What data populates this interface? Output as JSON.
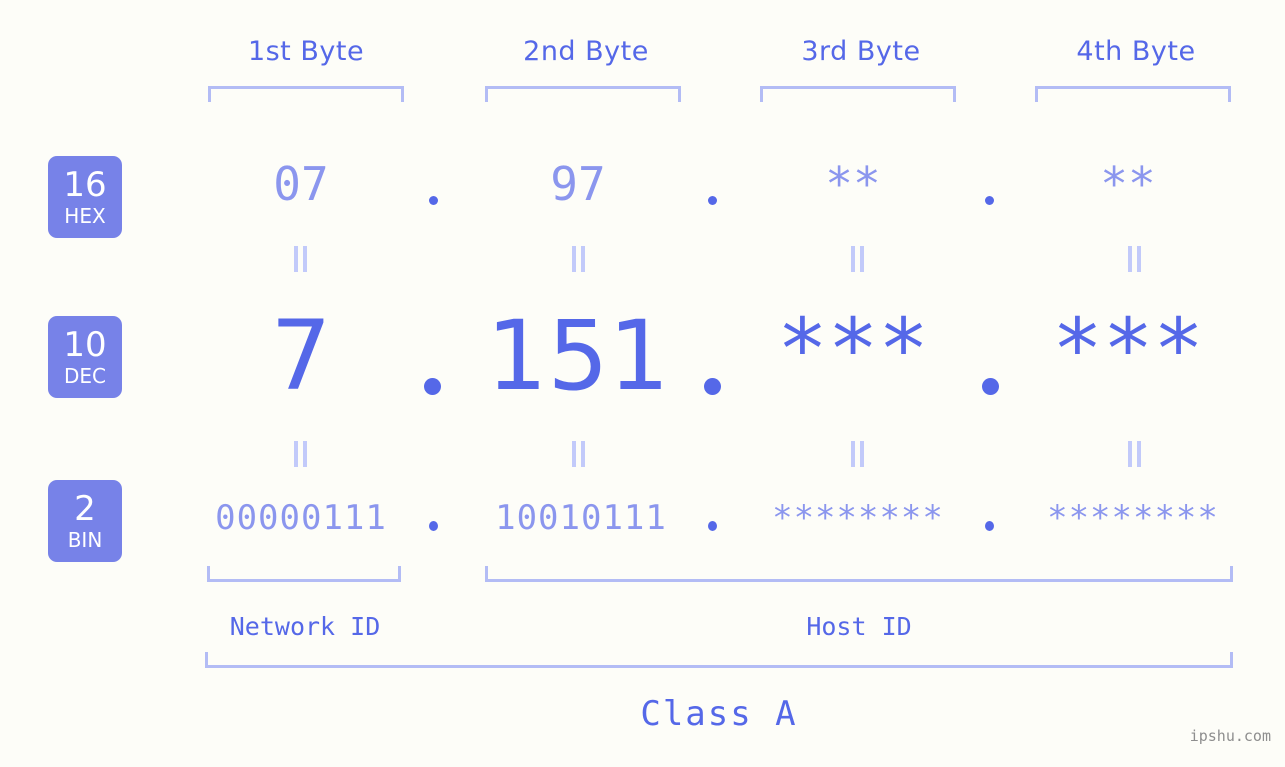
{
  "bytes": [
    {
      "header": "1st Byte"
    },
    {
      "header": "2nd Byte"
    },
    {
      "header": "3rd Byte"
    },
    {
      "header": "4th Byte"
    }
  ],
  "rows": [
    {
      "base": "16",
      "base_label": "HEX",
      "values": [
        "07",
        "97",
        "**",
        "**"
      ]
    },
    {
      "base": "10",
      "base_label": "DEC",
      "values": [
        "7",
        "151",
        "***",
        "***"
      ]
    },
    {
      "base": "2",
      "base_label": "BIN",
      "values": [
        "00000111",
        "10010111",
        "********",
        "********"
      ]
    }
  ],
  "sections": {
    "network_id": "Network ID",
    "host_id": "Host ID"
  },
  "class_label": "Class A",
  "watermark": "ipshu.com",
  "colors": {
    "accent": "#5568e8",
    "light_accent": "#8b96ee",
    "bracket": "#b3bcf5",
    "badge_bg": "#7782e8",
    "background": "#fdfdf8"
  }
}
